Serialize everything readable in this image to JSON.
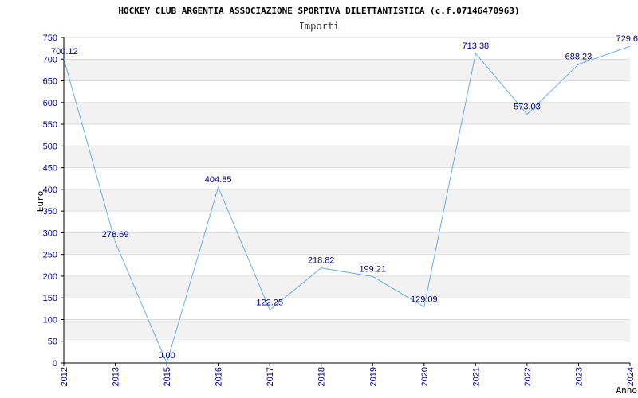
{
  "chart_data": {
    "type": "line",
    "title": "HOCKEY CLUB ARGENTIA ASSOCIAZIONE SPORTIVA DILETTANTISTICA (c.f.07146470963)",
    "subtitle": "Importi",
    "xlabel": "Anno",
    "ylabel": "Euro",
    "x": [
      "2012",
      "2013",
      "2015",
      "2016",
      "2017",
      "2018",
      "2019",
      "2020",
      "2021",
      "2022",
      "2023",
      "2024"
    ],
    "series": [
      {
        "values": [
          700.12,
          278.69,
          0.0,
          404.85,
          122.25,
          218.82,
          199.21,
          129.09,
          713.38,
          573.03,
          688.23,
          729.6
        ],
        "labels": [
          "700.12",
          "278.69",
          "0.00",
          "404.85",
          "122.25",
          "218.82",
          "199.21",
          "129.09",
          "713.38",
          "573.03",
          "688.23",
          "729.6"
        ]
      }
    ],
    "ylim": [
      0,
      750
    ],
    "yticks": [
      "0",
      "50",
      "100",
      "150",
      "200",
      "250",
      "300",
      "350",
      "400",
      "450",
      "500",
      "550",
      "600",
      "650",
      "700",
      "750"
    ],
    "grid": true,
    "line_color": "#6aaee8",
    "band_color": "#f2f2f2",
    "text_color": "#00008b"
  }
}
